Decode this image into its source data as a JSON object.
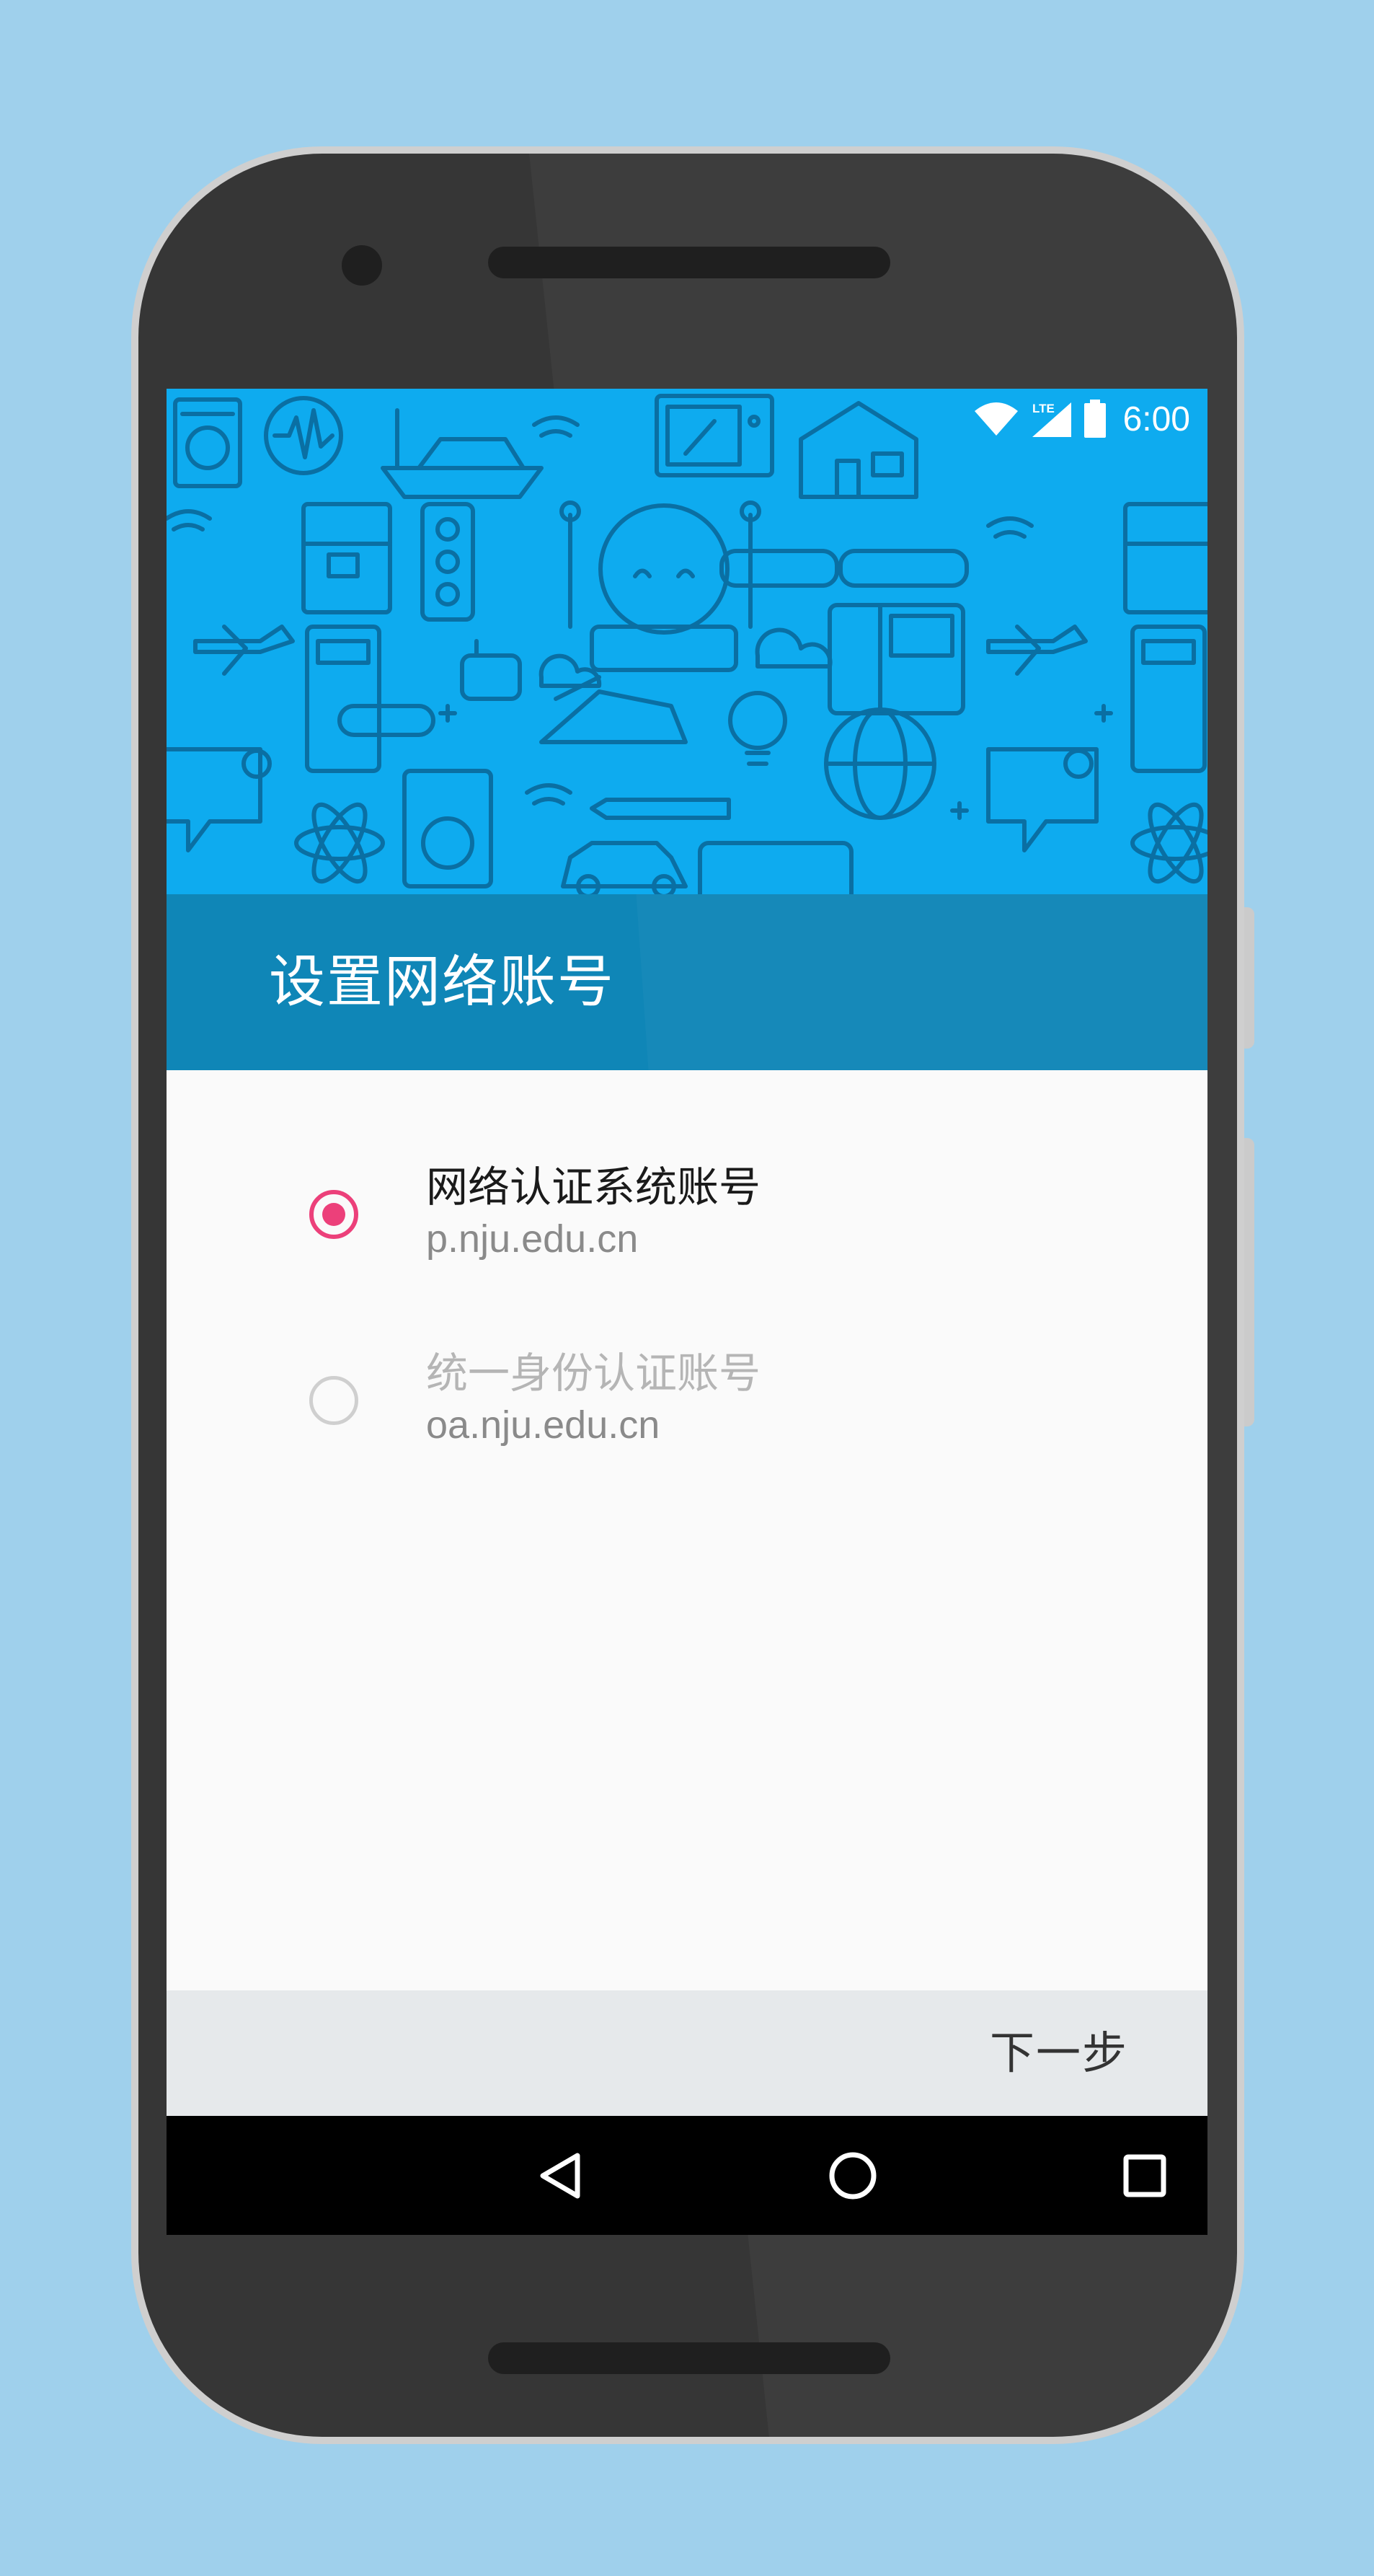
{
  "colors": {
    "background": "#9fd0ec",
    "hero": "#0eabef",
    "title_bar": "#0f86b7",
    "accent": "#ec407a",
    "footer": "#e6e9eb"
  },
  "status_bar": {
    "network_label": "LTE",
    "time": "6:00",
    "icons": [
      "wifi-icon",
      "cell-signal-icon",
      "battery-icon"
    ]
  },
  "header": {
    "title": "设置网络账号",
    "illustration": "appliances-pattern"
  },
  "options": [
    {
      "title": "网络认证系统账号",
      "subtitle": "p.nju.edu.cn",
      "selected": true
    },
    {
      "title": "统一身份认证账号",
      "subtitle": "oa.nju.edu.cn",
      "selected": false
    }
  ],
  "footer": {
    "next_label": "下一步"
  },
  "nav_bar": {
    "icons": [
      "back-icon",
      "home-icon",
      "recents-icon"
    ]
  }
}
